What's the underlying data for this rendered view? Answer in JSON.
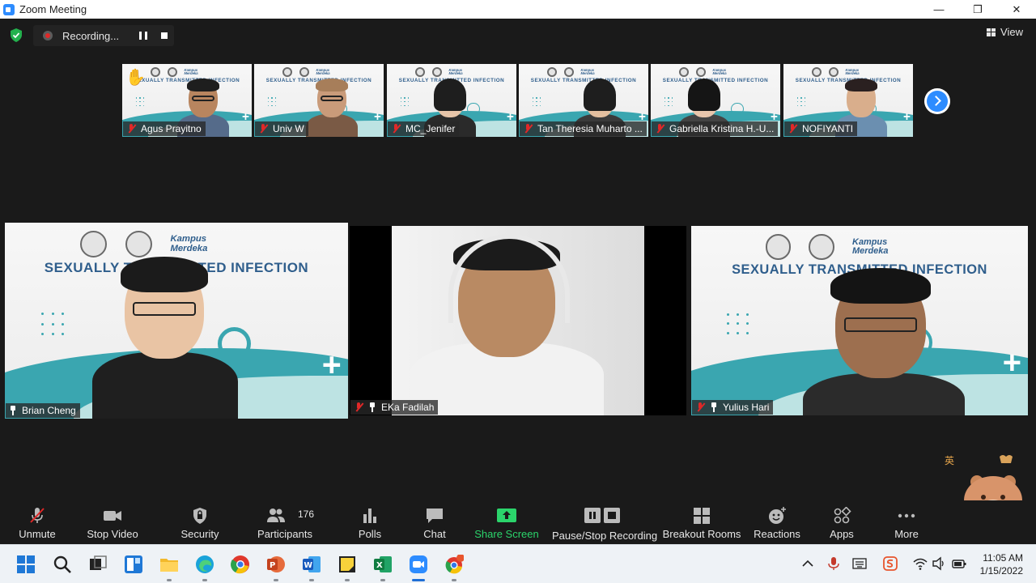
{
  "window": {
    "title": "Zoom Meeting",
    "minimize": "—",
    "restore": "❐",
    "close": "✕"
  },
  "recording": {
    "status": "Recording..."
  },
  "view_button": "View",
  "banner": {
    "headline": "SEXUALLY TRANSMITTED INFECTION",
    "kampus": "Kampus Merdeka"
  },
  "gallery": [
    {
      "name": "Agus Prayitno",
      "muted": true,
      "hand_raised": true
    },
    {
      "name": "Univ W",
      "muted": true
    },
    {
      "name": "MC_Jenifer",
      "muted": true
    },
    {
      "name": "Tan Theresia Muharto ...",
      "muted": true
    },
    {
      "name": "Gabriella Kristina H.-U...",
      "muted": true
    },
    {
      "name": "NOFIYANTI",
      "muted": true
    }
  ],
  "main_tiles": [
    {
      "name": "Brian Cheng",
      "muted": false,
      "pinned": true,
      "speaking": true
    },
    {
      "name": "EKa Fadilah",
      "muted": true,
      "pinned": true
    },
    {
      "name": "Yulius Hari",
      "muted": true,
      "pinned": true
    }
  ],
  "toolbar": {
    "unmute": "Unmute",
    "stop_video": "Stop Video",
    "security": "Security",
    "participants": "Participants",
    "participants_count": "176",
    "polls": "Polls",
    "chat": "Chat",
    "share_screen": "Share Screen",
    "recording": "Pause/Stop Recording",
    "breakout": "Breakout Rooms",
    "reactions": "Reactions",
    "apps": "Apps",
    "more": "More"
  },
  "colors": {
    "accent": "#2d8cff",
    "speaking_border": "#cfe84f",
    "share_green": "#2bd46b",
    "mute_red": "#e02828"
  },
  "taskbar": {
    "time": "11:05 AM",
    "date": "1/15/2022"
  }
}
